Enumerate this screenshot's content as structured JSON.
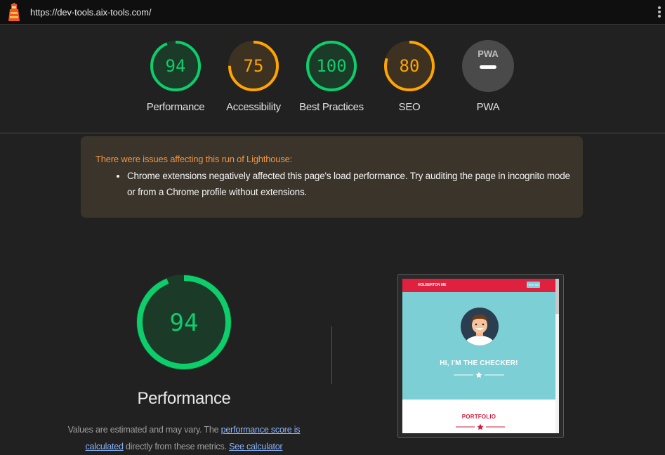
{
  "header": {
    "url": "https://dev-tools.aix-tools.com/",
    "logo_icon": "lighthouse-icon",
    "menu_icon": "kebab-menu-icon"
  },
  "categories": [
    {
      "label": "Performance",
      "score": "94",
      "color": "#0cce6b"
    },
    {
      "label": "Accessibility",
      "score": "75",
      "color": "#ffa400"
    },
    {
      "label": "Best Practices",
      "score": "100",
      "color": "#0cce6b"
    },
    {
      "label": "SEO",
      "score": "80",
      "color": "#ffa400"
    },
    {
      "label": "PWA",
      "badge": "PWA"
    }
  ],
  "warning": {
    "title": "There were issues affecting this run of Lighthouse:",
    "items": [
      "Chrome extensions negatively affected this page's load performance. Try auditing the page in incognito mode or from a Chrome profile without extensions."
    ]
  },
  "performance": {
    "score": "94",
    "title": "Performance",
    "color": "#0cce6b",
    "note_prefix": "Values are estimated and may vary. The ",
    "note_link1": "performance score is calculated",
    "note_middle": " directly from these metrics. ",
    "note_link2": "See calculator"
  },
  "screenshot": {
    "brand": "HOLBERTON ME",
    "nav_button": "HIRE ME",
    "hero_text": "HI, I'M THE CHECKER!",
    "section_title": "PORTFOLIO"
  }
}
